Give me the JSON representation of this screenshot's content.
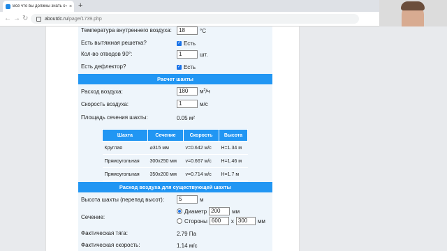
{
  "browser": {
    "tab_title": "Всё что вы должны знать о естестве",
    "tab_close": "×",
    "new_tab": "+",
    "url_host": "aboutdc.ru",
    "url_path": "/page/1739.php"
  },
  "inputs_top": {
    "indoor_temp_label": "Температура внутреннего воздуха:",
    "indoor_temp_value": "18",
    "indoor_temp_unit": "°С",
    "grille_label": "Есть вытяжная решетка?",
    "grille_text": "Есть",
    "bends_label": "Кол-во отводов 90°:",
    "bends_value": "1",
    "bends_unit": "шт.",
    "deflector_label": "Есть дефлектор?",
    "deflector_text": "Есть"
  },
  "shaft_calc": {
    "title": "Расчет шахты",
    "airflow_label": "Расход воздуха:",
    "airflow_value": "180",
    "airflow_unit_main": "м",
    "airflow_unit_sup": "3",
    "airflow_unit_tail": "/ч",
    "speed_label": "Скорость воздуха:",
    "speed_value": "1",
    "speed_unit": "м/с",
    "area_label": "Площадь сечения шахты:",
    "area_value": "0.05 м",
    "area_sup": "2"
  },
  "table": {
    "headers": [
      "Шахта",
      "Сечение",
      "Скорость",
      "Высота"
    ],
    "rows": [
      [
        "Круглая",
        "⌀315 мм",
        "v=0.642 м/с",
        "H=1.34 м"
      ],
      [
        "Прямоугольная",
        "300x250 мм",
        "v=0.667 м/с",
        "H=1.46 м"
      ],
      [
        "Прямоугольная",
        "350x200 мм",
        "v=0.714 м/с",
        "H=1.7 м"
      ]
    ]
  },
  "existing_shaft": {
    "title": "Расход воздуха для существующей шахты",
    "height_label": "Высота шахты (перепад высот):",
    "height_value": "5",
    "height_unit": "м",
    "section_label": "Сечение:",
    "diameter_label": "Диаметр",
    "diameter_value": "200",
    "diameter_unit": "мм",
    "sides_label": "Стороны",
    "side_a": "600",
    "times": "x",
    "side_b": "300",
    "sides_unit": "мм",
    "draft_label": "Фактическая тяга:",
    "draft_value": "2.79 Па",
    "speed_label": "Фактическая скорость:",
    "speed_value": "1.14 м/с"
  },
  "colors": {
    "accent": "#2196f3",
    "card_bg": "#eef5fb"
  }
}
